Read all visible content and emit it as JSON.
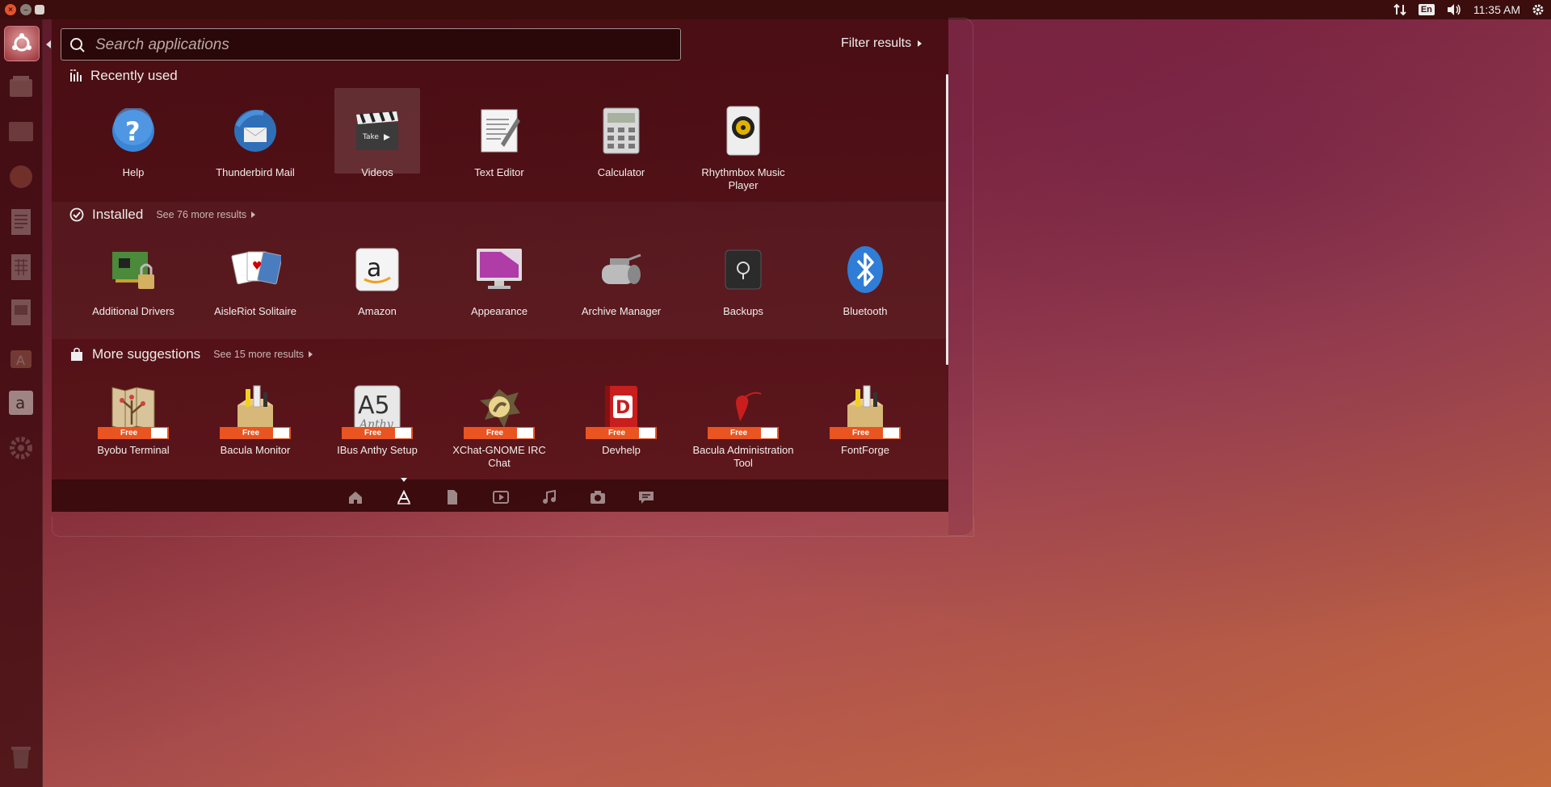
{
  "topbar": {
    "clock": "11:35 AM",
    "lang": "En"
  },
  "search": {
    "placeholder": "Search applications",
    "filter_label": "Filter results"
  },
  "sections": {
    "recent": {
      "title": "Recently used"
    },
    "installed": {
      "title": "Installed",
      "see_more": "See 76 more results"
    },
    "suggestions": {
      "title": "More suggestions",
      "see_more": "See 15 more results"
    }
  },
  "recent_apps": [
    {
      "label": "Help",
      "icon": "help-icon"
    },
    {
      "label": "Thunderbird Mail",
      "icon": "thunderbird-icon"
    },
    {
      "label": "Videos",
      "icon": "videos-icon"
    },
    {
      "label": "Text Editor",
      "icon": "text-editor-icon"
    },
    {
      "label": "Calculator",
      "icon": "calculator-icon"
    },
    {
      "label": "Rhythmbox Music Player",
      "icon": "rhythmbox-icon"
    }
  ],
  "installed_apps": [
    {
      "label": "Additional Drivers",
      "icon": "drivers-icon"
    },
    {
      "label": "AisleRiot Solitaire",
      "icon": "solitaire-icon"
    },
    {
      "label": "Amazon",
      "icon": "amazon-icon"
    },
    {
      "label": "Appearance",
      "icon": "appearance-icon"
    },
    {
      "label": "Archive Manager",
      "icon": "archive-icon"
    },
    {
      "label": "Backups",
      "icon": "backups-icon"
    },
    {
      "label": "Bluetooth",
      "icon": "bluetooth-icon"
    }
  ],
  "suggested_apps": [
    {
      "label": "Byobu Terminal",
      "icon": "byobu-icon",
      "badge": "Free"
    },
    {
      "label": "Bacula Monitor",
      "icon": "bacula-monitor-icon",
      "badge": "Free"
    },
    {
      "label": "IBus Anthy Setup",
      "icon": "anthy-icon",
      "badge": "Free"
    },
    {
      "label": "XChat-GNOME IRC Chat",
      "icon": "xchat-icon",
      "badge": "Free"
    },
    {
      "label": "Devhelp",
      "icon": "devhelp-icon",
      "badge": "Free"
    },
    {
      "label": "Bacula Administration Tool",
      "icon": "bacula-admin-icon",
      "badge": "Free"
    },
    {
      "label": "FontForge",
      "icon": "fontforge-icon",
      "badge": "Free"
    }
  ],
  "colors": {
    "accent": "#e95420",
    "panel": "#3b0d0d"
  }
}
